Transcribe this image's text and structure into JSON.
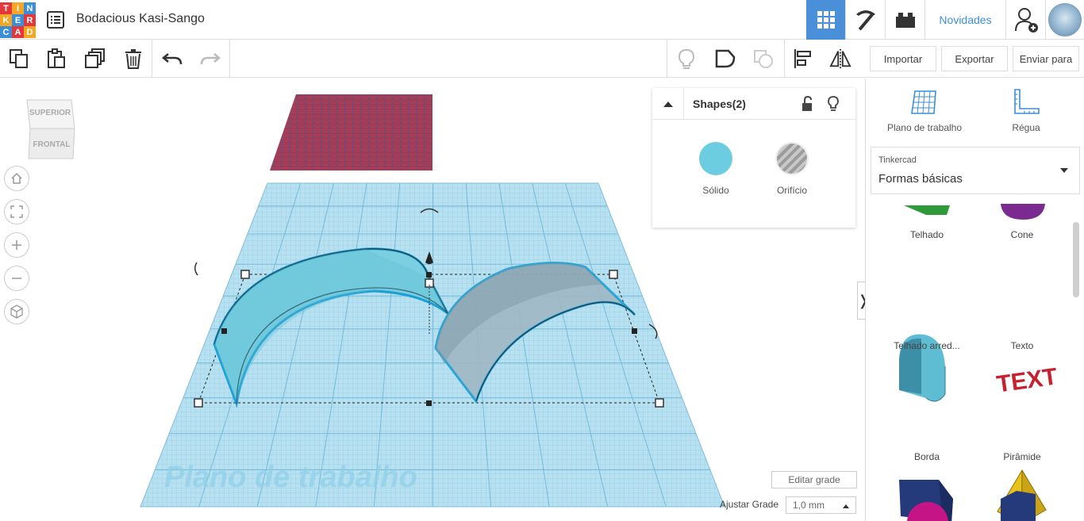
{
  "app": {
    "logo_letters": [
      "T",
      "I",
      "N",
      "K",
      "E",
      "R",
      "C",
      "A",
      "D"
    ],
    "logo_colors": [
      "#e3373e",
      "#f5a623",
      "#3c8fd6",
      "#f5a623",
      "#3c8fd6",
      "#e3373e",
      "#3c8fd6",
      "#e3373e",
      "#f5a623"
    ],
    "design_title": "Bodacious Kasi-Sango",
    "news_label": "Novidades"
  },
  "right_toolbar": {
    "import_label": "Importar",
    "export_label": "Exportar",
    "send_label": "Enviar para"
  },
  "viewcube": {
    "top_label": "SUPERIOR",
    "front_label": "FRONTAL"
  },
  "inspector": {
    "title": "Shapes(2)",
    "solid_label": "Sólido",
    "hole_label": "Orifício",
    "solid_color": "#6ccde0"
  },
  "workplane": {
    "watermark": "Plano de trabalho",
    "edit_grid_label": "Editar grade",
    "snap_label": "Ajustar Grade",
    "snap_value": "1,0 mm"
  },
  "side_panel": {
    "workplane_tool": "Plano de trabalho",
    "ruler_tool": "Régua",
    "library_source": "Tinkercad",
    "library_name": "Formas básicas",
    "shapes": [
      {
        "label": "Telhado",
        "icon": "roof-shape-icon"
      },
      {
        "label": "Cone",
        "icon": "cone-shape-icon"
      },
      {
        "label": "Telhado arred...",
        "icon": "round-roof-shape-icon"
      },
      {
        "label": "Texto",
        "icon": "text-shape-icon"
      },
      {
        "label": "Borda",
        "icon": "wedge-shape-icon"
      },
      {
        "label": "Pirâmide",
        "icon": "pyramid-shape-icon"
      }
    ]
  }
}
